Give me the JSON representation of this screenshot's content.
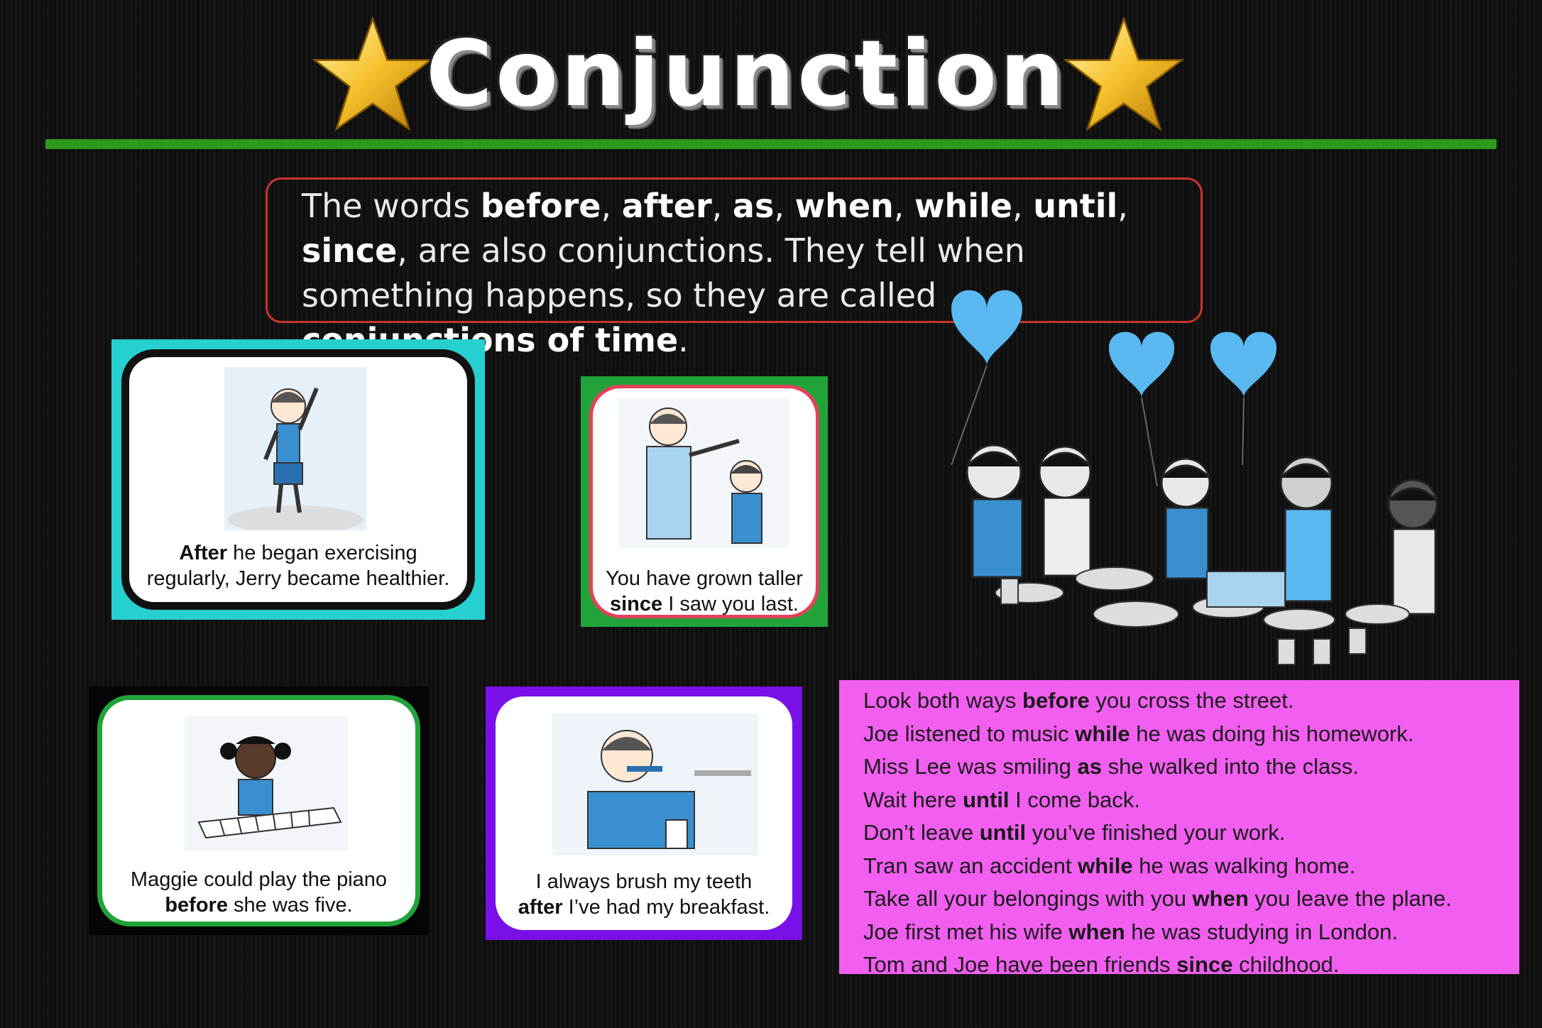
{
  "title": "Conjunction",
  "intro": {
    "segments": [
      {
        "text": "The words ",
        "bold": false
      },
      {
        "text": "before",
        "bold": true
      },
      {
        "text": ", ",
        "bold": false
      },
      {
        "text": "after",
        "bold": true
      },
      {
        "text": ", ",
        "bold": false
      },
      {
        "text": "as",
        "bold": true
      },
      {
        "text": ", ",
        "bold": false
      },
      {
        "text": "when",
        "bold": true
      },
      {
        "text": ", ",
        "bold": false
      },
      {
        "text": "while",
        "bold": true
      },
      {
        "text": ", ",
        "bold": false
      },
      {
        "text": "until",
        "bold": true
      },
      {
        "text": ", ",
        "bold": false
      },
      {
        "text": "since",
        "bold": true
      },
      {
        "text": ", are also conjunctions. They tell when something happens, so they are called ",
        "bold": false
      },
      {
        "text": "conjunctions of time",
        "bold": true
      },
      {
        "text": ".",
        "bold": false
      }
    ]
  },
  "cards": [
    {
      "frame_color": "#26d0d0",
      "inner_border": "#111111",
      "picture": "boy-exercising-icon",
      "line1": [
        {
          "text": "After",
          "bold": true
        },
        {
          "text": " he began exercising",
          "bold": false
        }
      ],
      "line2": [
        {
          "text": "regularly, Jerry became healthier.",
          "bold": false
        }
      ]
    },
    {
      "frame_color": "#22a33a",
      "inner_border": "#e8405a",
      "picture": "man-and-boy-icon",
      "line1": [
        {
          "text": "You have grown taller",
          "bold": false
        }
      ],
      "line2": [
        {
          "text": "since",
          "bold": true
        },
        {
          "text": " I saw you last.",
          "bold": false
        }
      ]
    },
    {
      "frame_color": "#050505",
      "inner_border": "#22a33a",
      "picture": "girl-piano-icon",
      "line1": [
        {
          "text": "Maggie could play the piano",
          "bold": false
        }
      ],
      "line2": [
        {
          "text": "before",
          "bold": true
        },
        {
          "text": " she was five.",
          "bold": false
        }
      ]
    },
    {
      "frame_color": "#7a10e8",
      "inner_border": "#7a10e8",
      "picture": "boy-brushing-teeth-icon",
      "line1": [
        {
          "text": "I always brush my teeth",
          "bold": false
        }
      ],
      "line2": [
        {
          "text": "after",
          "bold": true
        },
        {
          "text": " I’ve had my breakfast.",
          "bold": false
        }
      ]
    }
  ],
  "examples": [
    [
      {
        "text": "Look both ways ",
        "bold": false
      },
      {
        "text": "before",
        "bold": true
      },
      {
        "text": " you cross the street.",
        "bold": false
      }
    ],
    [
      {
        "text": "Joe listened to music ",
        "bold": false
      },
      {
        "text": "while",
        "bold": true
      },
      {
        "text": " he was doing his homework.",
        "bold": false
      }
    ],
    [
      {
        "text": "Miss Lee was smiling ",
        "bold": false
      },
      {
        "text": "as",
        "bold": true
      },
      {
        "text": " she walked into the class.",
        "bold": false
      }
    ],
    [
      {
        "text": "Wait here ",
        "bold": false
      },
      {
        "text": "until",
        "bold": true
      },
      {
        "text": " I come back.",
        "bold": false
      }
    ],
    [
      {
        "text": "Don’t leave ",
        "bold": false
      },
      {
        "text": "until",
        "bold": true
      },
      {
        "text": " you’ve finished your work.",
        "bold": false
      }
    ],
    [
      {
        "text": "Tran saw an accident ",
        "bold": false
      },
      {
        "text": "while",
        "bold": true
      },
      {
        "text": " he was walking home.",
        "bold": false
      }
    ],
    [
      {
        "text": "Take all your belongings with you ",
        "bold": false
      },
      {
        "text": "when",
        "bold": true
      },
      {
        "text": " you leave the plane.",
        "bold": false
      }
    ],
    [
      {
        "text": "Joe first met his wife ",
        "bold": false
      },
      {
        "text": "when",
        "bold": true
      },
      {
        "text": " he was studying in London.",
        "bold": false
      }
    ],
    [
      {
        "text": "Tom and Joe have been friends ",
        "bold": false
      },
      {
        "text": "since",
        "bold": true
      },
      {
        "text": " childhood.",
        "bold": false
      }
    ]
  ],
  "icons": [
    "star-icon",
    "party-children-icon",
    "heart-balloon-icon"
  ],
  "colors": {
    "rule": "#2e9a1c",
    "intro_border": "#c8362a",
    "examples_bg": "#f25ef0",
    "balloon": "#5ab8f0"
  }
}
